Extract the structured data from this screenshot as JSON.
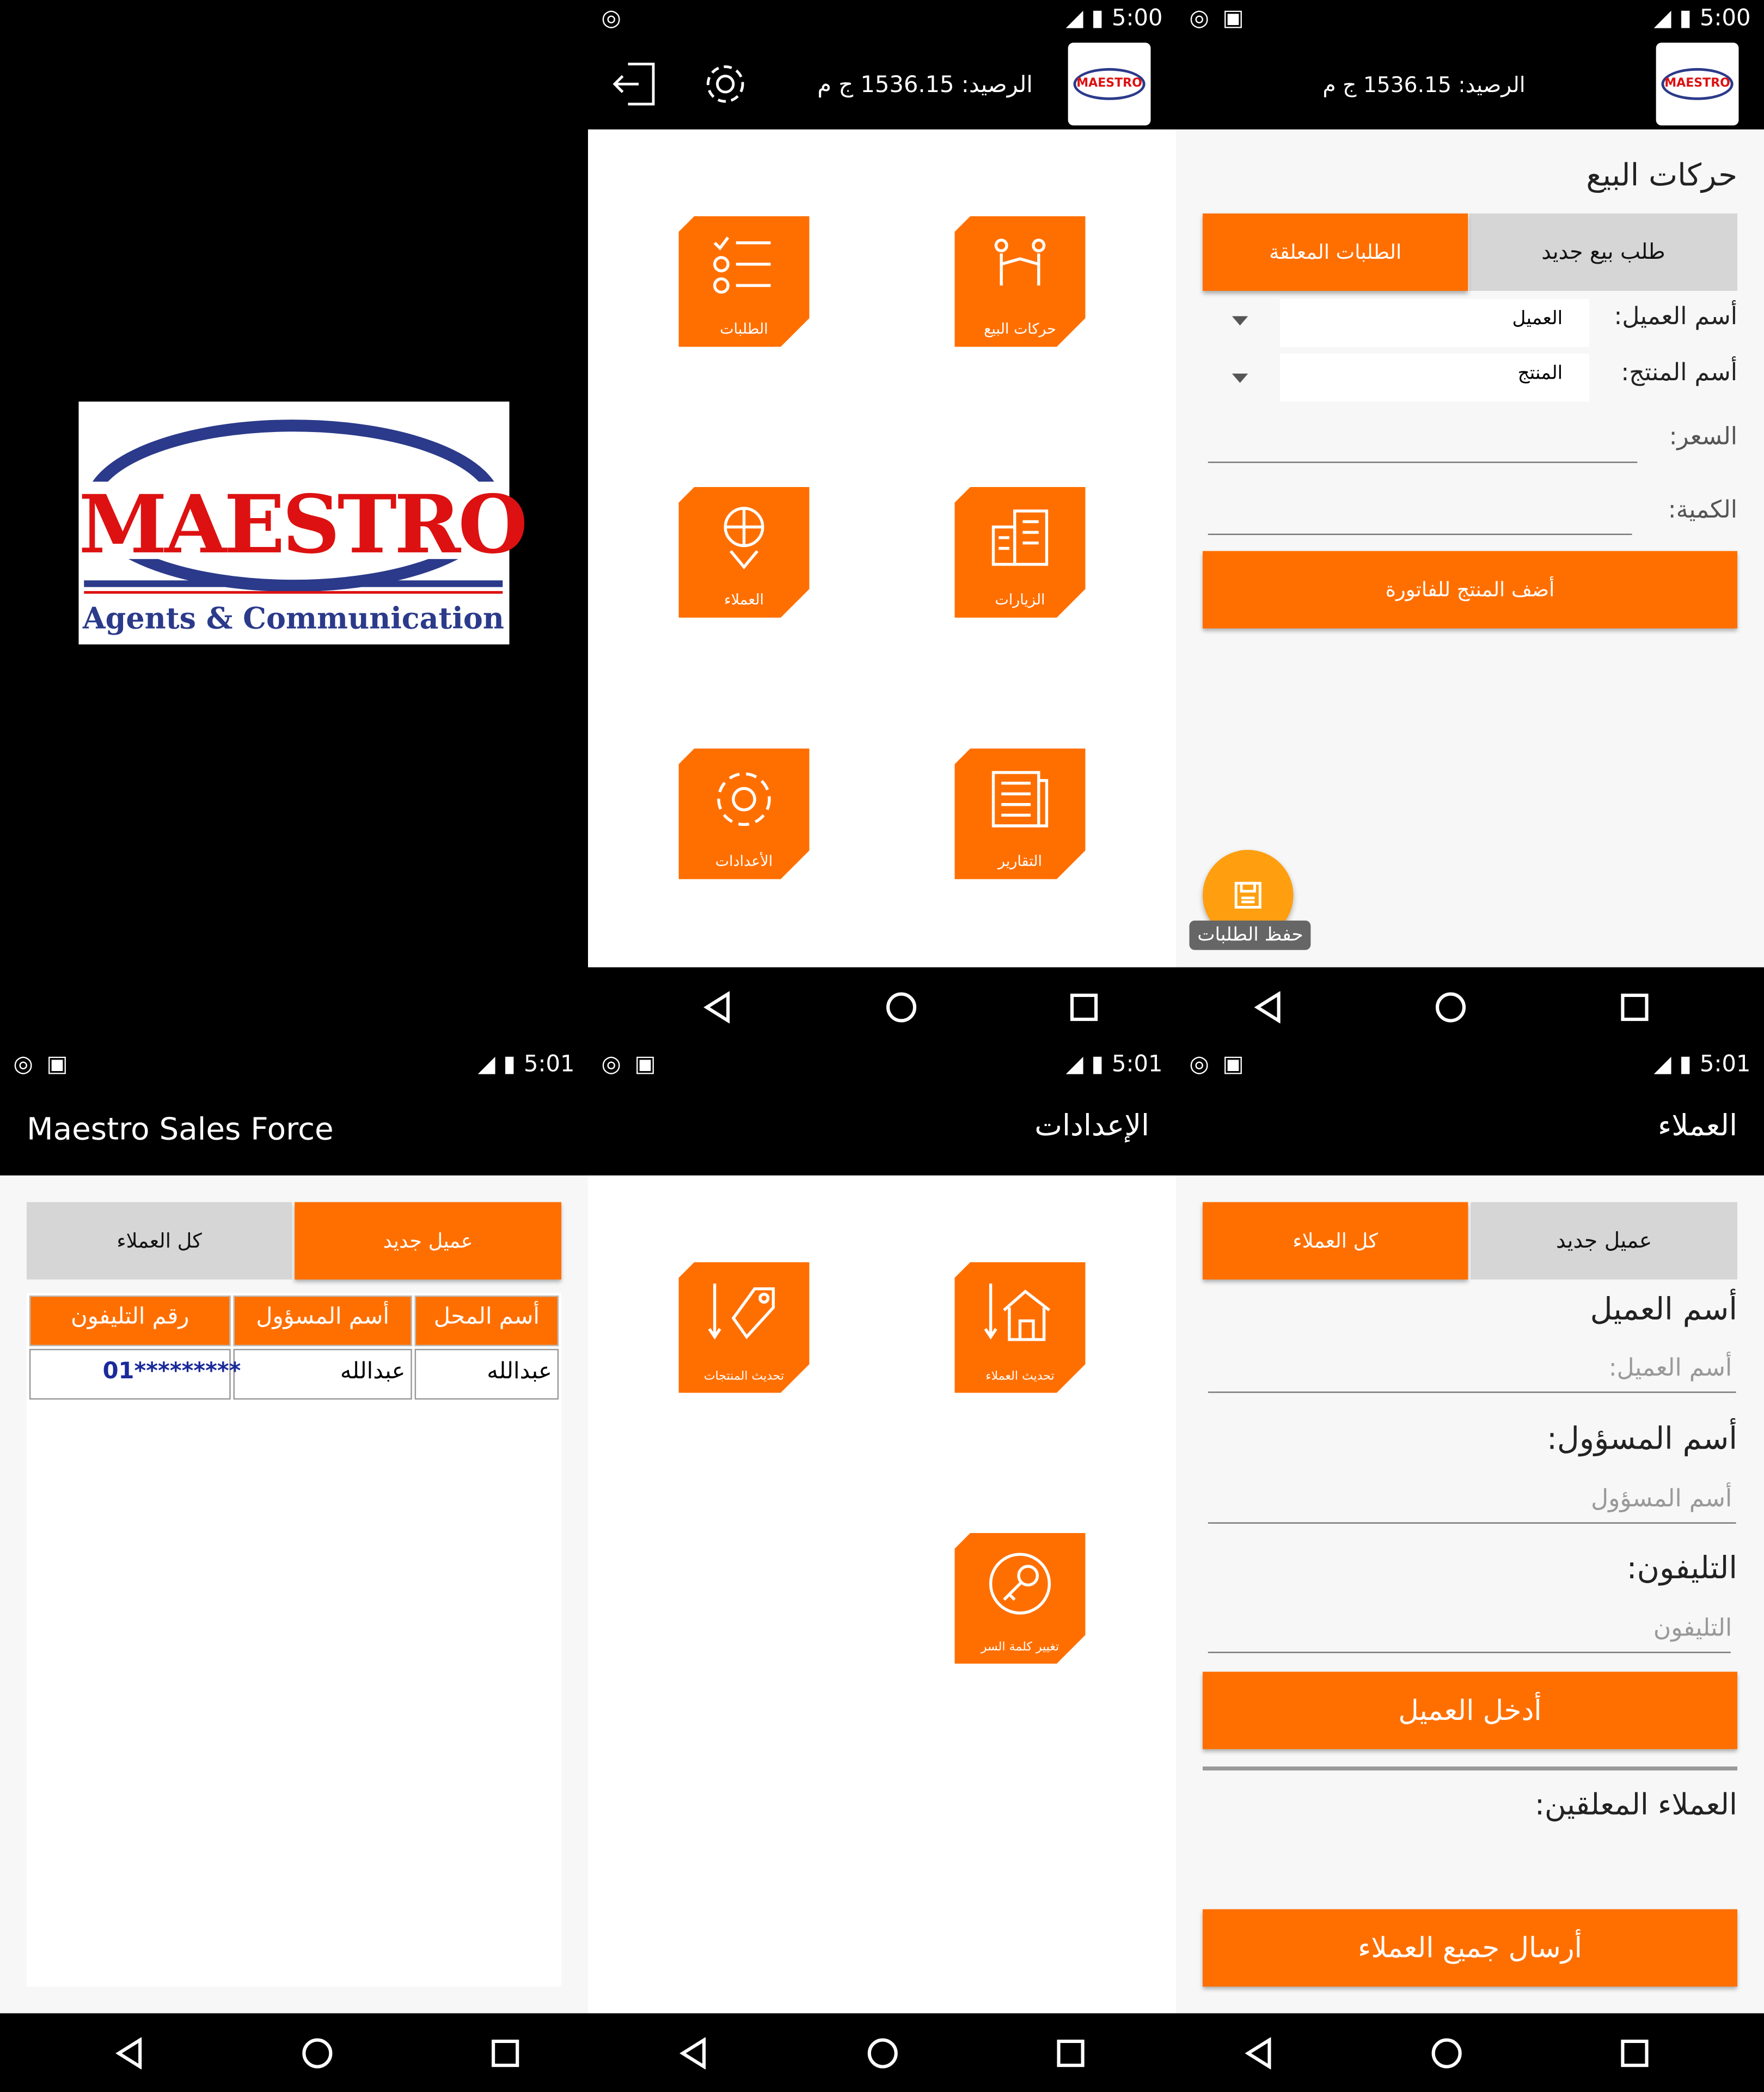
{
  "status": {
    "time1": "5:00",
    "time2": "5:01"
  },
  "balance": "الرصيد: 1536.15 ج م",
  "logo": {
    "brand": "MAESTRO",
    "tagline": "Agents & Communication",
    "small": "MAESTRO"
  },
  "home": {
    "tiles": [
      "حركات البيع",
      "الطلبات",
      "الزيارات",
      "العملاء",
      "التقارير",
      "الأعدادات"
    ]
  },
  "sales": {
    "title": "حركات البيع",
    "tab_new": "طلب بيع جديد",
    "tab_pending": "الطلبات المعلقة",
    "customer_label": "أسم العميل:",
    "customer_value": "العميل",
    "product_label": "أسم المنتج:",
    "product_value": "المنتج",
    "price_label": "السعر:",
    "qty_label": "الكمية:",
    "add_btn": "أضف المنتج للفاتورة",
    "save_tip": "حفظ الطلبات"
  },
  "list": {
    "appbar": "Maestro Sales Force",
    "tab_all": "كل العملاء",
    "tab_new": "عميل جديد",
    "headers": [
      "أسم المحل",
      "أسم المسؤول",
      "رقم التليفون"
    ],
    "row": [
      "عبدالله",
      "عبدالله",
      "01*********"
    ]
  },
  "settings": {
    "appbar": "الإعدادات",
    "tiles": [
      "تحديث العملاء",
      "تحديث المنتجات",
      "تغيير كلمة السر"
    ]
  },
  "customers": {
    "appbar": "العملاء",
    "tab_new": "عميل جديد",
    "tab_all": "كل العملاء",
    "name_label": "أسم العميل",
    "name_ph": "أسم العميل:",
    "resp_label": "أسم المسؤول:",
    "resp_ph": "أسم المسؤول",
    "phone_label": "التليفون:",
    "phone_ph": "التليفون",
    "enter_btn": "أدخل العميل",
    "pending_label": "العملاء المعلقين:",
    "send_btn": "أرسال جميع العملاء"
  }
}
